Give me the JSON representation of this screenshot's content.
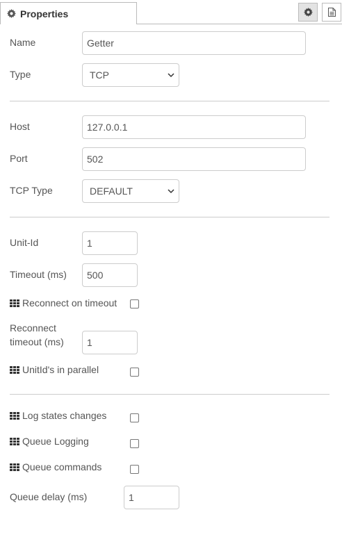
{
  "tabs": {
    "properties_label": "Properties"
  },
  "fields": {
    "name_label": "Name",
    "name_value": "Getter",
    "type_label": "Type",
    "type_value": "TCP",
    "host_label": "Host",
    "host_value": "127.0.0.1",
    "port_label": "Port",
    "port_value": "502",
    "tcp_type_label": "TCP Type",
    "tcp_type_value": "DEFAULT",
    "unit_id_label": "Unit-Id",
    "unit_id_value": "1",
    "timeout_label": "Timeout (ms)",
    "timeout_value": "500",
    "reconnect_on_timeout_label": "Reconnect on timeout",
    "reconnect_timeout_label": "Reconnect timeout (ms)",
    "reconnect_timeout_value": "1",
    "unitids_parallel_label": "UnitId's in parallel",
    "log_states_label": "Log states changes",
    "queue_logging_label": "Queue Logging",
    "queue_commands_label": "Queue commands",
    "queue_delay_label": "Queue delay (ms)",
    "queue_delay_value": "1"
  },
  "icons": {
    "tab": "gear-icon",
    "settings_button": "gear-icon",
    "description_button": "document-icon",
    "checkbox_labels": "grid-icon",
    "select_arrow": "chevron-down-icon"
  }
}
